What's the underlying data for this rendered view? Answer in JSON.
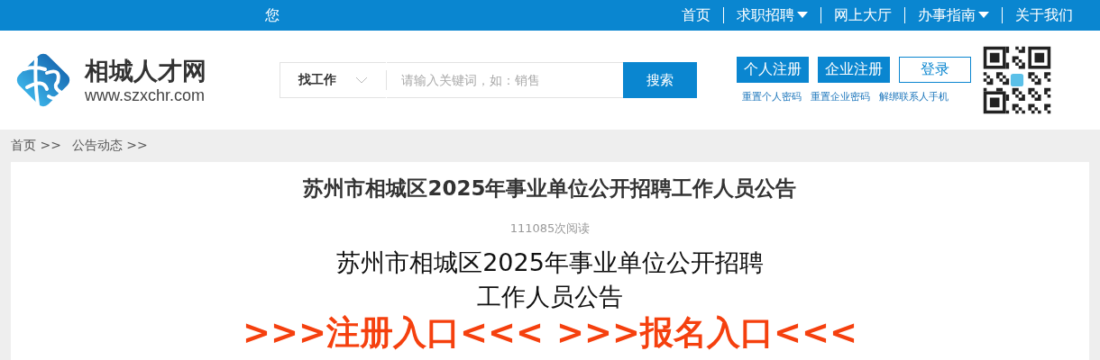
{
  "top_bar": {
    "greeting": "您",
    "nav": [
      {
        "label": "首页",
        "dropdown": false
      },
      {
        "label": "求职招聘",
        "dropdown": true
      },
      {
        "label": "网上大厅",
        "dropdown": false
      },
      {
        "label": "办事指南",
        "dropdown": true
      },
      {
        "label": "关于我们",
        "dropdown": false
      }
    ]
  },
  "header": {
    "site_name": "相城人才网",
    "site_url": "www.szxchr.com",
    "search": {
      "category": "找工作",
      "placeholder": "请输入关键词，如：销售",
      "button": "搜索"
    },
    "account_buttons": [
      {
        "label": "个人注册",
        "kind": "filled"
      },
      {
        "label": "企业注册",
        "kind": "filled"
      },
      {
        "label": "登录",
        "kind": "outline"
      }
    ],
    "account_links": [
      "重置个人密码",
      "重置企业密码",
      "解绑联系人手机"
    ]
  },
  "breadcrumb": [
    "首页 >>",
    "公告动态 >>"
  ],
  "article": {
    "title": "苏州市相城区2025年事业单位公开招聘工作人员公告",
    "views": "111085次阅读",
    "heading_lines": [
      "苏州市相城区2025年事业单位公开招聘",
      "工作人员公告"
    ],
    "entry_links": [
      ">>>注册入口<<<",
      ">>>报名入口<<<"
    ]
  }
}
